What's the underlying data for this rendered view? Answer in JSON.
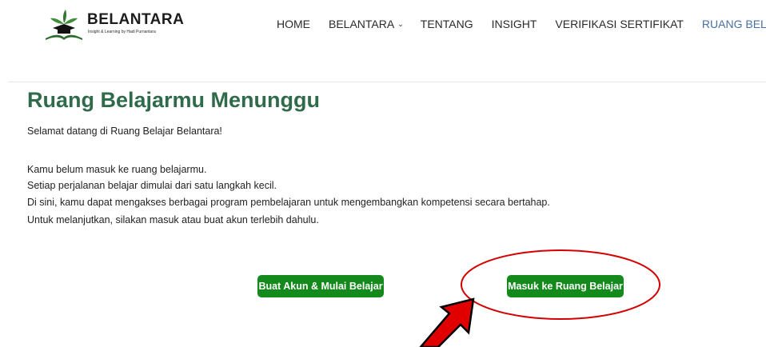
{
  "header": {
    "brand": "BELANTARA",
    "tagline": "Insight & Learning by Hadi Purnantara",
    "nav": [
      {
        "label": "HOME"
      },
      {
        "label": "BELANTARA"
      },
      {
        "label": "TENTANG"
      },
      {
        "label": "INSIGHT"
      },
      {
        "label": "VERIFIKASI SERTIFIKAT"
      },
      {
        "label": "RUANG BELAJAR"
      }
    ],
    "nav_dropdown_icon": "chevron-down-icon",
    "active_color": "#4a6fa5"
  },
  "main": {
    "title": "Ruang Belajarmu Menunggu",
    "title_color": "#2f6b4a",
    "welcome": "Selamat datang di Ruang Belajar Belantara!",
    "paragraphs": [
      "Kamu belum masuk ke ruang belajarmu.",
      "Setiap perjalanan belajar dimulai dari satu langkah kecil.",
      "Di sini, kamu dapat mengakses berbagai program pembelajaran untuk mengembangkan kompetensi secara bertahap.",
      "Untuk melanjutkan, silakan masuk atau buat akun terlebih dahulu."
    ],
    "buttons": {
      "register": "Buat Akun & Mulai Belajar",
      "login": "Masuk ke Ruang Belajar"
    },
    "button_color": "#14891c"
  },
  "annotation": {
    "highlight_color": "#d40000",
    "icons": [
      "circle-highlight",
      "red-arrow-icon"
    ]
  }
}
